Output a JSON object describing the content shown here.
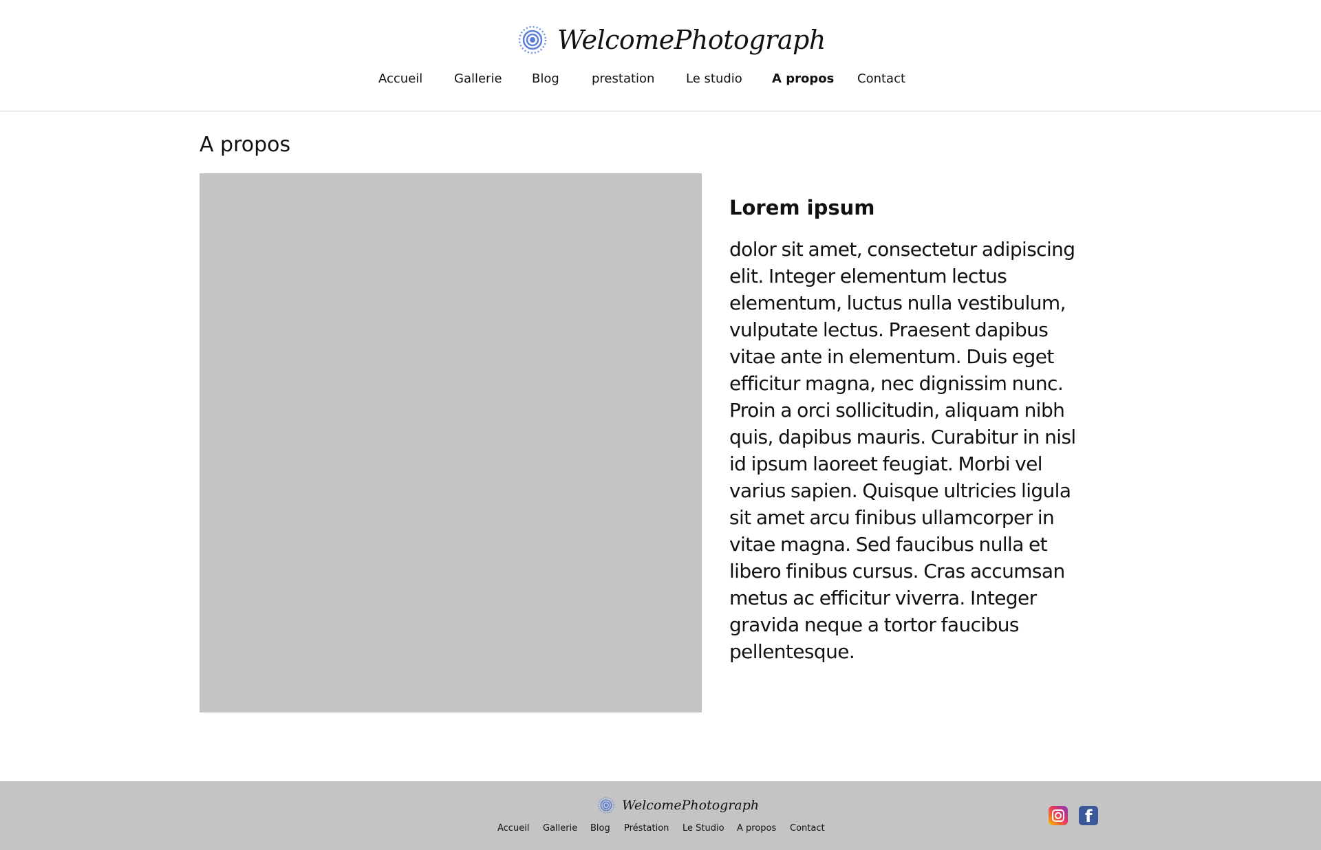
{
  "header": {
    "brand_name": "WelcomePhotograph",
    "nav": [
      {
        "label": "Accueil"
      },
      {
        "label": "Gallerie"
      },
      {
        "label": "Blog"
      },
      {
        "label": "prestation"
      },
      {
        "label": "Le studio"
      },
      {
        "label": "A propos",
        "active": true
      },
      {
        "label": "Contact"
      }
    ]
  },
  "main": {
    "page_title": "A propos",
    "article_title": "Lorem ipsum",
    "article_body": "dolor sit amet, consectetur adipiscing elit. Integer elementum lectus elementum, luctus nulla vestibulum, vulputate lectus. Praesent dapibus vitae ante in elementum. Duis eget efficitur magna, nec dignissim nunc. Proin a orci sollicitudin, aliquam nibh quis, dapibus mauris. Curabitur in nisl id ipsum laoreet feugiat. Morbi vel varius sapien. Quisque ultricies ligula sit amet arcu finibus ullamcorper in vitae magna. Sed faucibus nulla et libero finibus cursus. Cras accumsan metus ac efficitur viverra. Integer gravida neque a tortor faucibus pellentesque."
  },
  "footer": {
    "brand_name": "WelcomePhotograph",
    "nav": [
      {
        "label": "Accueil"
      },
      {
        "label": "Gallerie"
      },
      {
        "label": "Blog"
      },
      {
        "label": "Préstation"
      },
      {
        "label": "Le Studio"
      },
      {
        "label": "A propos"
      },
      {
        "label": "Contact"
      }
    ],
    "social": [
      {
        "icon": "instagram-icon"
      },
      {
        "icon": "facebook-icon"
      }
    ]
  },
  "colors": {
    "logo_blue": "#5b7fd6",
    "placeholder_gray": "#c4c4c4",
    "footer_bg": "#c4c4c4",
    "facebook_blue": "#3b5998"
  }
}
